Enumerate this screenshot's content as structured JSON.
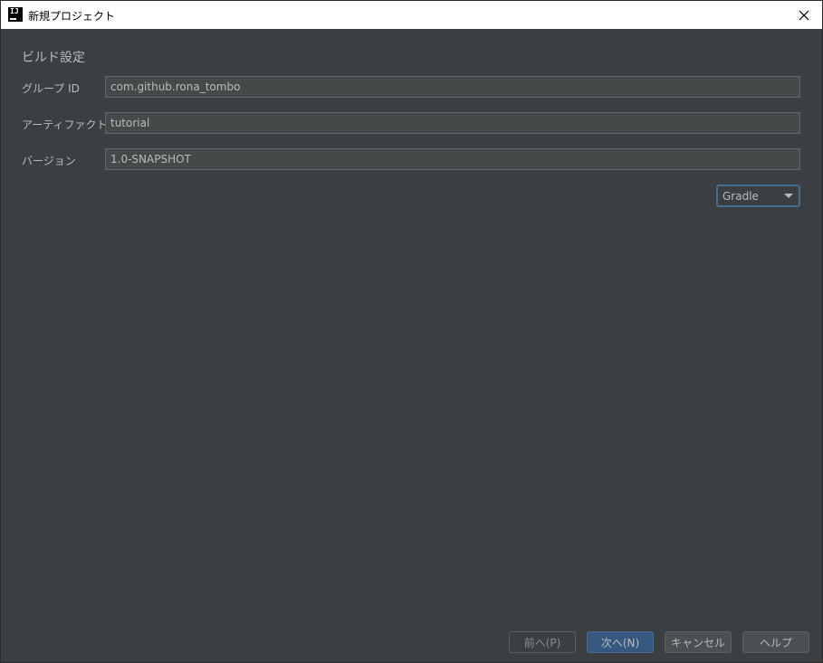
{
  "window": {
    "title": "新規プロジェクト"
  },
  "build_settings": {
    "section_title": "ビルド設定",
    "group_id": {
      "label": "グループ ID",
      "value": "com.github.rona_tombo"
    },
    "artifact_id": {
      "label": "アーティファクト ID",
      "value": "tutorial"
    },
    "version": {
      "label": "バージョン",
      "value": "1.0-SNAPSHOT"
    },
    "build_tool": {
      "selected": "Gradle"
    }
  },
  "footer": {
    "prev": "前へ(P)",
    "next": "次へ(N)",
    "cancel": "キャンセル",
    "help": "ヘルプ"
  },
  "colors": {
    "background": "#3c3f41",
    "input_background": "#45494a",
    "primary_button": "#365880",
    "focus_border": "#466d94"
  },
  "icons": {
    "app": "intellij-idea-icon",
    "close": "close-icon",
    "dropdown": "chevron-down-icon"
  }
}
